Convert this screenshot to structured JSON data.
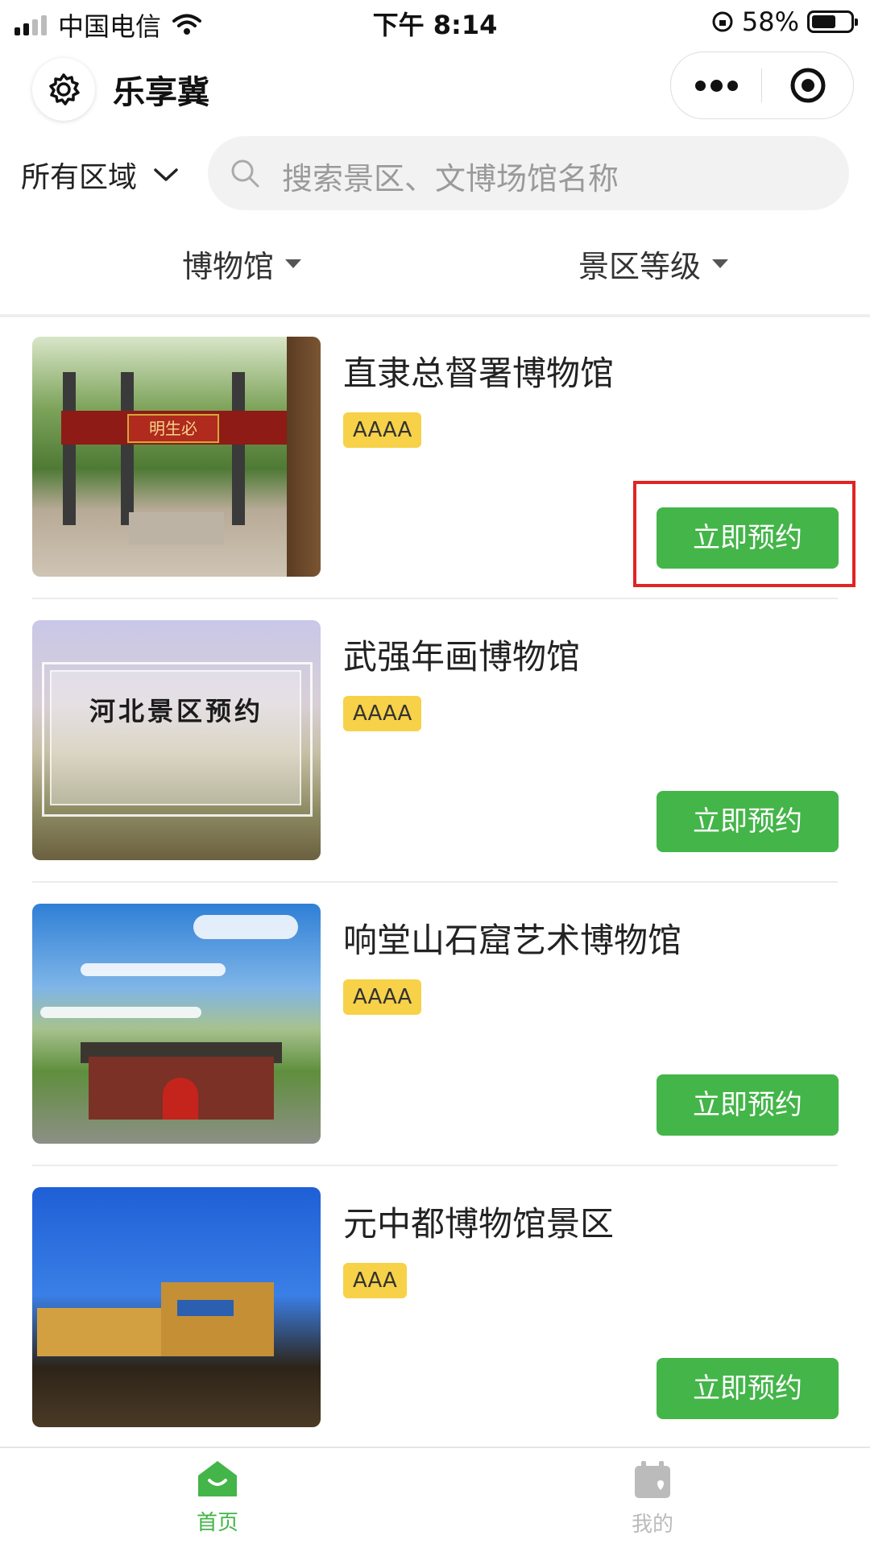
{
  "status_bar": {
    "carrier": "中国电信",
    "time": "下午 8:14",
    "battery": "58%"
  },
  "header": {
    "title": "乐享冀"
  },
  "search": {
    "region": "所有区域",
    "placeholder": "搜索景区、文博场馆名称"
  },
  "filters": [
    {
      "label": "博物馆"
    },
    {
      "label": "景区等级"
    }
  ],
  "items": [
    {
      "name": "直隶总督署博物馆",
      "level": "AAAA",
      "button": "立即预约"
    },
    {
      "name": "武强年画博物馆",
      "level": "AAAA",
      "button": "立即预约",
      "image_caption": "河北景区预约"
    },
    {
      "name": "响堂山石窟艺术博物馆",
      "level": "AAAA",
      "button": "立即预约"
    },
    {
      "name": "元中都博物馆景区",
      "level": "AAA",
      "button": "立即预约"
    }
  ],
  "tabbar": {
    "items": [
      {
        "label": "首页",
        "active": true
      },
      {
        "label": "我的",
        "active": false
      }
    ]
  },
  "colors": {
    "accent": "#44b549",
    "badge": "#f7d148",
    "highlight": "#e02424",
    "inactive": "#bbbbbb"
  }
}
